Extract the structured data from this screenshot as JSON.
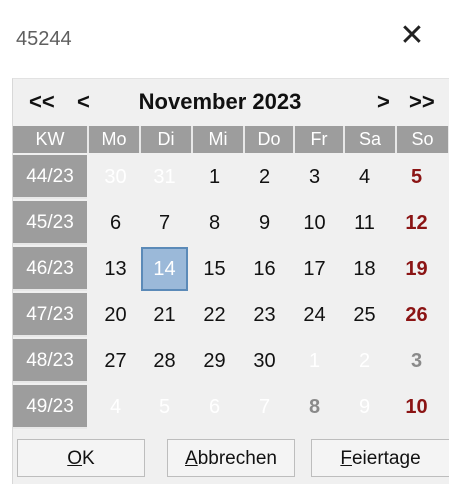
{
  "window": {
    "title": "45244",
    "close_glyph": "✕"
  },
  "nav": {
    "prev_year": "<<",
    "prev_month": "<",
    "month_label": "November 2023",
    "next_month": ">",
    "next_year": ">>"
  },
  "header": [
    "KW",
    "Mo",
    "Di",
    "Mi",
    "Do",
    "Fr",
    "Sa",
    "So"
  ],
  "weeks": [
    {
      "kw": "44/23",
      "days": [
        "30",
        "31",
        "1",
        "2",
        "3",
        "4",
        "5"
      ]
    },
    {
      "kw": "45/23",
      "days": [
        "6",
        "7",
        "8",
        "9",
        "10",
        "11",
        "12"
      ]
    },
    {
      "kw": "46/23",
      "days": [
        "13",
        "14",
        "15",
        "16",
        "17",
        "18",
        "19"
      ]
    },
    {
      "kw": "47/23",
      "days": [
        "20",
        "21",
        "22",
        "23",
        "24",
        "25",
        "26"
      ]
    },
    {
      "kw": "48/23",
      "days": [
        "27",
        "28",
        "29",
        "30",
        "1",
        "2",
        "3"
      ]
    },
    {
      "kw": "49/23",
      "days": [
        "4",
        "5",
        "6",
        "7",
        "8",
        "9",
        "10"
      ]
    }
  ],
  "selected_day": "14",
  "buttons": {
    "ok_mnemonic": "O",
    "ok_rest": "K",
    "cancel_mnemonic": "A",
    "cancel_rest": "bbrechen",
    "holidays_mnemonic": "F",
    "holidays_rest": "eiertage"
  },
  "colors": {
    "header_bg": "#9d9d9d",
    "sunday": "#8b1414",
    "selected_bg": "#9bb9d9"
  }
}
